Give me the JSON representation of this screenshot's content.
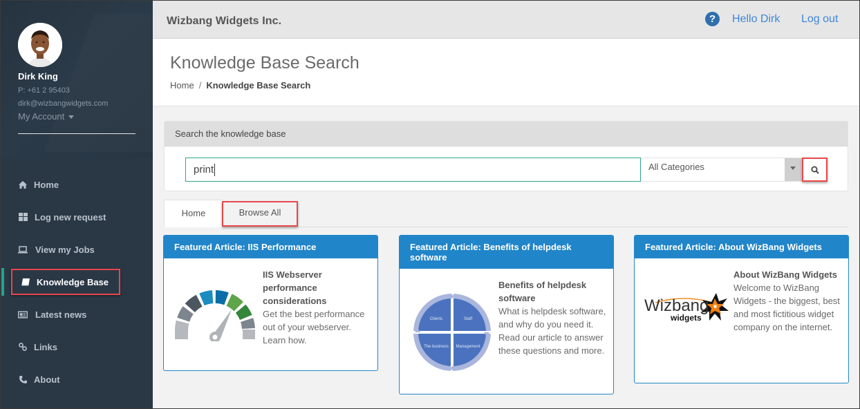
{
  "sidebar": {
    "user": {
      "name": "Dirk King",
      "phone": "P: +61 2 95403",
      "email": "dirk@wizbangwidgets.com",
      "account_label": "My Account"
    },
    "items": [
      {
        "label": "Home",
        "icon": "home-icon"
      },
      {
        "label": "Log new request",
        "icon": "grid-icon"
      },
      {
        "label": "View my Jobs",
        "icon": "laptop-icon"
      },
      {
        "label": "Knowledge Base",
        "icon": "book-icon",
        "active": true
      },
      {
        "label": "Latest news",
        "icon": "newspaper-icon"
      },
      {
        "label": "Links",
        "icon": "link-icon"
      },
      {
        "label": "About",
        "icon": "phone-icon"
      }
    ]
  },
  "topbar": {
    "brand": "Wizbang Widgets Inc.",
    "help_icon": "?",
    "greeting": "Hello Dirk",
    "logout": "Log out"
  },
  "header": {
    "title": "Knowledge Base Search",
    "breadcrumb": {
      "home": "Home",
      "separator": "/",
      "current": "Knowledge Base Search"
    }
  },
  "search": {
    "panel_title": "Search the knowledge base",
    "query": "print",
    "category": "All Categories"
  },
  "tabs": [
    {
      "label": "Home",
      "active": true
    },
    {
      "label": "Browse All",
      "active": false
    }
  ],
  "cards": [
    {
      "header": "Featured Article: IIS Performance",
      "title": "IIS Webserver performance considerations",
      "body": "Get the best performance out of your webserver. Learn how.",
      "image": "speedometer-icon"
    },
    {
      "header": "Featured Article: Benefits of helpdesk software",
      "title": "Benefits of helpdesk software",
      "body": "What is helpdesk software, and why do you need it. Read our article to answer these questions and more.",
      "image": "cycle-diagram",
      "diagram_labels": [
        "Clients",
        "Staff",
        "The business",
        "Management"
      ]
    },
    {
      "header": "Featured Article: About WizBang Widgets",
      "title": "About WizBang Widgets",
      "body": "Welcome to WizBang Widgets - the biggest, best and most fictitious widget company on the internet.",
      "image": "wizbang-logo",
      "logo_text": "Wizbang",
      "logo_subtext": "widgets"
    }
  ],
  "colors": {
    "sidebar_bg": "#2a3846",
    "accent_green": "#1fa68a",
    "card_blue": "#2185c9",
    "link_blue": "#3f86d8",
    "highlight_red": "#e8474a"
  }
}
